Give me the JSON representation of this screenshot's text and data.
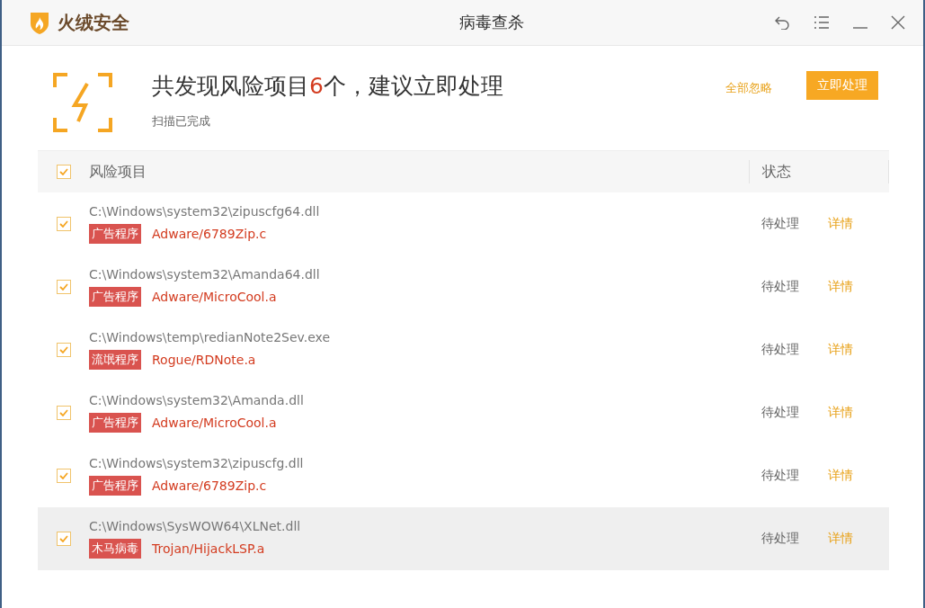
{
  "window": {
    "brand": "火绒安全",
    "title": "病毒查杀"
  },
  "summary": {
    "text_before": "共发现风险项目",
    "count": "6",
    "text_after": "个，建议立即处理",
    "subtitle": "扫描已完成"
  },
  "actions": {
    "ignore_all": "全部忽略",
    "handle_now": "立即处理"
  },
  "table": {
    "select_all": true,
    "columns": [
      "风险项目",
      "状态"
    ],
    "rows": [
      {
        "checked": true,
        "selected": false,
        "path": "C:\\Windows\\system32\\zipuscfg64.dll",
        "category": "广告程序",
        "threat": "Adware/6789Zip.c",
        "status": "待处理",
        "details": "详情"
      },
      {
        "checked": true,
        "selected": false,
        "path": "C:\\Windows\\system32\\Amanda64.dll",
        "category": "广告程序",
        "threat": "Adware/MicroCool.a",
        "status": "待处理",
        "details": "详情"
      },
      {
        "checked": true,
        "selected": false,
        "path": "C:\\Windows\\temp\\redianNote2Sev.exe",
        "category": "流氓程序",
        "threat": "Rogue/RDNote.a",
        "status": "待处理",
        "details": "详情"
      },
      {
        "checked": true,
        "selected": false,
        "path": "C:\\Windows\\system32\\Amanda.dll",
        "category": "广告程序",
        "threat": "Adware/MicroCool.a",
        "status": "待处理",
        "details": "详情"
      },
      {
        "checked": true,
        "selected": false,
        "path": "C:\\Windows\\system32\\zipuscfg.dll",
        "category": "广告程序",
        "threat": "Adware/6789Zip.c",
        "status": "待处理",
        "details": "详情"
      },
      {
        "checked": true,
        "selected": true,
        "path": "C:\\Windows\\SysWOW64\\XLNet.dll",
        "category": "木马病毒",
        "threat": "Trojan/HijackLSP.a",
        "status": "待处理",
        "details": "详情"
      }
    ]
  }
}
